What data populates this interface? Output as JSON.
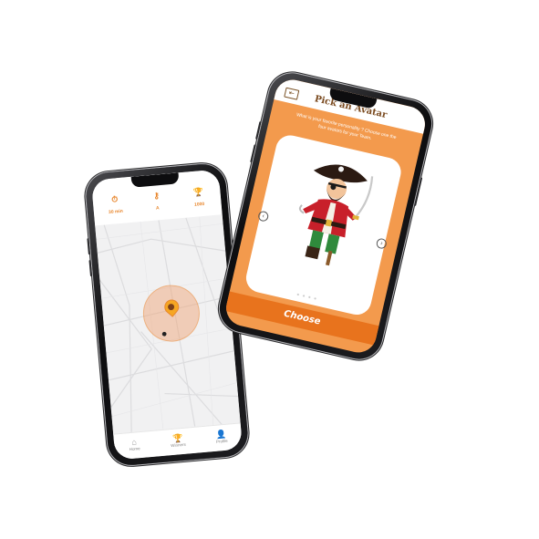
{
  "map_phone": {
    "stats": [
      {
        "icon": "stopwatch-icon",
        "glyph": "⏱",
        "value": "30 min"
      },
      {
        "icon": "key-icon",
        "glyph": "⚷",
        "value": "A"
      },
      {
        "icon": "trophy-icon",
        "glyph": "🏆",
        "value": "1000"
      }
    ],
    "nav": [
      {
        "icon": "home-icon",
        "glyph": "⌂",
        "label": "Home"
      },
      {
        "icon": "trophy-icon",
        "glyph": "🏆",
        "label": "Winners"
      },
      {
        "icon": "profile-icon",
        "glyph": "👤",
        "label": "Profile"
      }
    ]
  },
  "avatar_phone": {
    "title": "Pick an Avatar",
    "prompt": "What is your favorite personality ? Choose one the four avatars for your Team.",
    "choose_label": "Choose",
    "prev_glyph": "‹",
    "next_glyph": "›",
    "back_glyph": "⇤",
    "pagination_dots": "● ● ● ●"
  },
  "colors": {
    "accent": "#e8872e",
    "header_orange": "#f39a4d",
    "button_orange": "#e8731d",
    "title_brown": "#7a4a1f"
  }
}
